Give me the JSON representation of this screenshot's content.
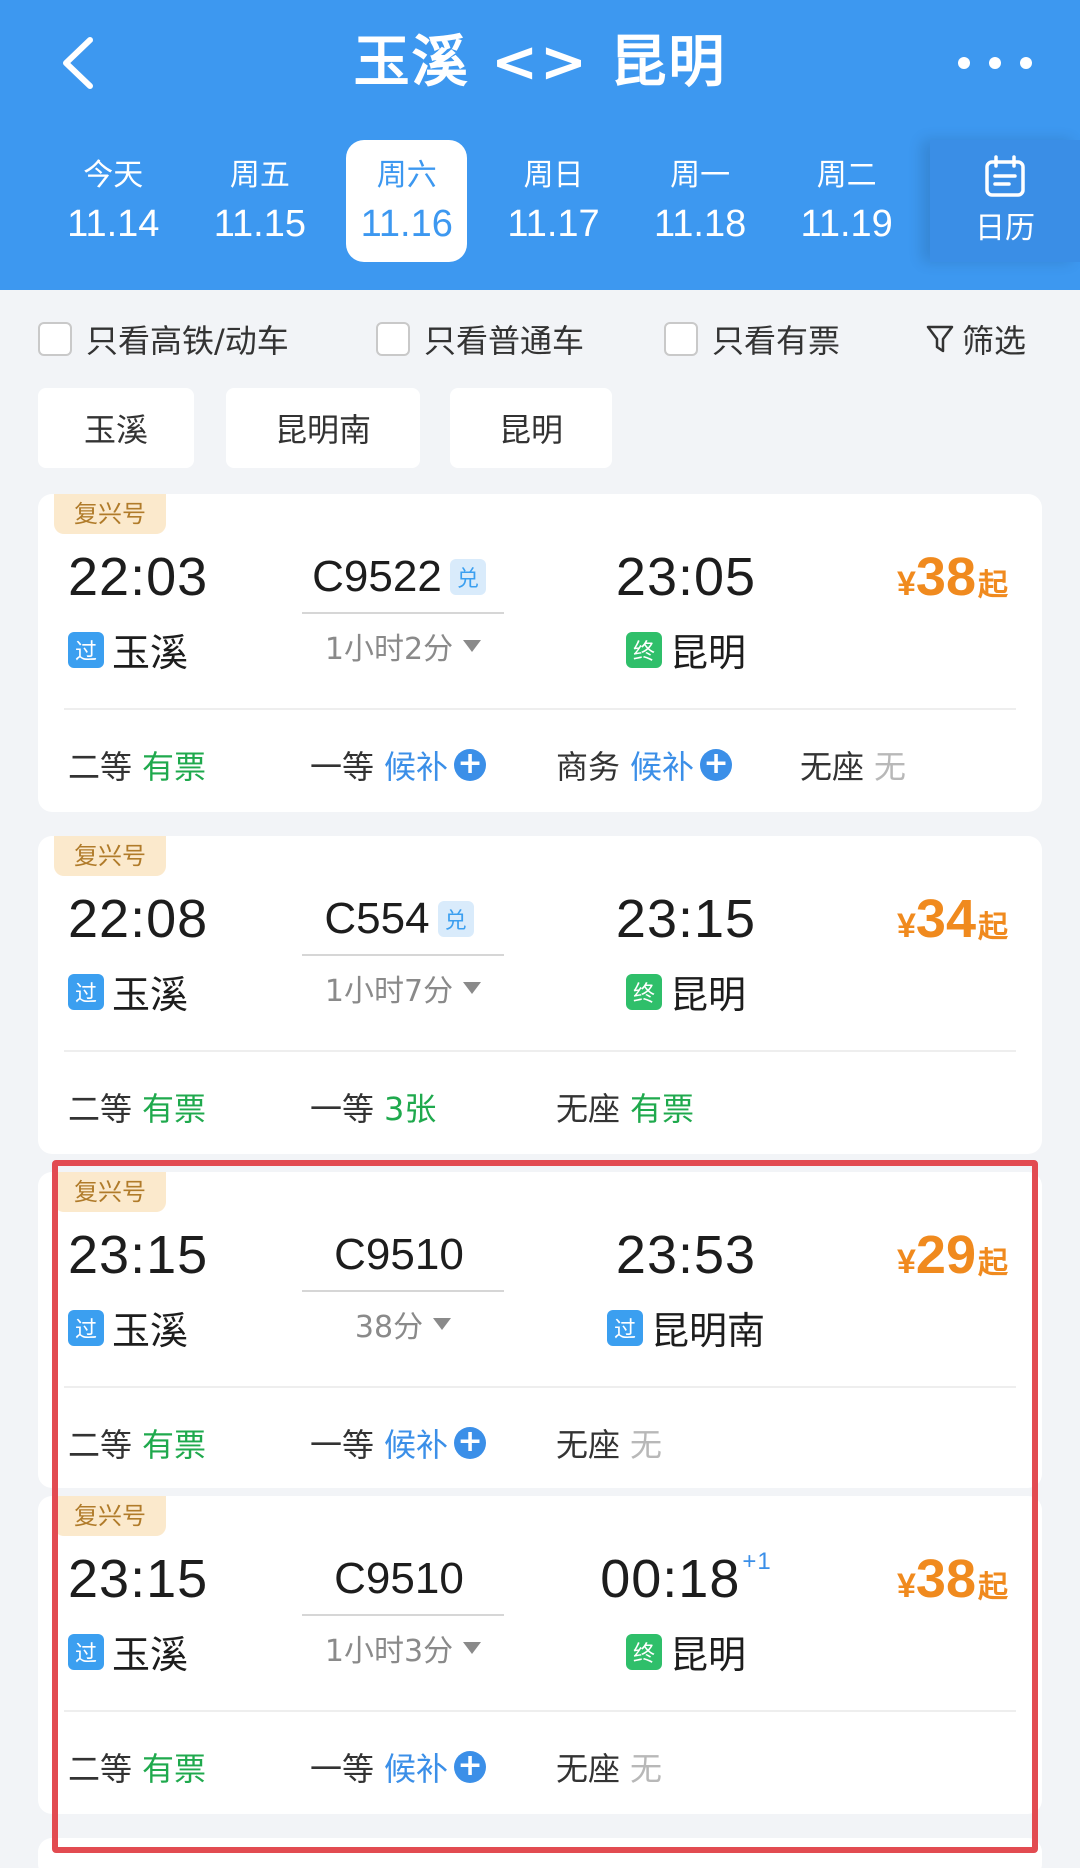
{
  "header": {
    "title": "玉溪 <> 昆明",
    "back_icon": "chevron-left-icon",
    "more_icon": "more-dots-icon",
    "calendar_label": "日历",
    "dates": [
      {
        "weekday": "今天",
        "date": "11.14",
        "active": false
      },
      {
        "weekday": "周五",
        "date": "11.15",
        "active": false
      },
      {
        "weekday": "周六",
        "date": "11.16",
        "active": true
      },
      {
        "weekday": "周日",
        "date": "11.17",
        "active": false
      },
      {
        "weekday": "周一",
        "date": "11.18",
        "active": false
      },
      {
        "weekday": "周二",
        "date": "11.19",
        "active": false
      }
    ]
  },
  "filters": {
    "gaotie_label": "只看高铁/动车",
    "putong_label": "只看普通车",
    "youpiao_label": "只看有票",
    "filter_label": "筛选"
  },
  "stations": [
    "玉溪",
    "昆明南",
    "昆明"
  ],
  "trains": [
    {
      "tag": "复兴号",
      "dep_time": "22:03",
      "dep_badge": "过",
      "dep_station": "玉溪",
      "train_no": "C9522",
      "exchange_badge": "兑",
      "duration": "1小时2分",
      "arr_time": "23:05",
      "arr_plus": "",
      "arr_badge": "终",
      "arr_station": "昆明",
      "price_symbol": "¥",
      "price": "38",
      "price_suffix": "起",
      "seats": [
        {
          "class": "二等",
          "status": "有票",
          "kind": "ok"
        },
        {
          "class": "一等",
          "status": "候补",
          "kind": "wait"
        },
        {
          "class": "商务",
          "status": "候补",
          "kind": "wait"
        },
        {
          "class": "无座",
          "status": "无",
          "kind": "no"
        }
      ]
    },
    {
      "tag": "复兴号",
      "dep_time": "22:08",
      "dep_badge": "过",
      "dep_station": "玉溪",
      "train_no": "C554",
      "exchange_badge": "兑",
      "duration": "1小时7分",
      "arr_time": "23:15",
      "arr_plus": "",
      "arr_badge": "终",
      "arr_station": "昆明",
      "price_symbol": "¥",
      "price": "34",
      "price_suffix": "起",
      "seats": [
        {
          "class": "二等",
          "status": "有票",
          "kind": "ok"
        },
        {
          "class": "一等",
          "status": "3张",
          "kind": "ok"
        },
        {
          "class": "无座",
          "status": "有票",
          "kind": "ok"
        }
      ]
    },
    {
      "tag": "复兴号",
      "dep_time": "23:15",
      "dep_badge": "过",
      "dep_station": "玉溪",
      "train_no": "C9510",
      "exchange_badge": "",
      "duration": "38分",
      "arr_time": "23:53",
      "arr_plus": "",
      "arr_badge": "过",
      "arr_station": "昆明南",
      "price_symbol": "¥",
      "price": "29",
      "price_suffix": "起",
      "seats": [
        {
          "class": "二等",
          "status": "有票",
          "kind": "ok"
        },
        {
          "class": "一等",
          "status": "候补",
          "kind": "wait"
        },
        {
          "class": "无座",
          "status": "无",
          "kind": "no"
        }
      ]
    },
    {
      "tag": "复兴号",
      "dep_time": "23:15",
      "dep_badge": "过",
      "dep_station": "玉溪",
      "train_no": "C9510",
      "exchange_badge": "",
      "duration": "1小时3分",
      "arr_time": "00:18",
      "arr_plus": "+1",
      "arr_badge": "终",
      "arr_station": "昆明",
      "price_symbol": "¥",
      "price": "38",
      "price_suffix": "起",
      "seats": [
        {
          "class": "二等",
          "status": "有票",
          "kind": "ok"
        },
        {
          "class": "一等",
          "status": "候补",
          "kind": "wait"
        },
        {
          "class": "无座",
          "status": "无",
          "kind": "no"
        }
      ]
    }
  ],
  "colors": {
    "header_blue": "#3d98f0",
    "price_orange": "#f08a1e",
    "available_green": "#1fa94d",
    "waitlist_blue": "#3b8fe8",
    "highlight_red": "#e24b51"
  }
}
